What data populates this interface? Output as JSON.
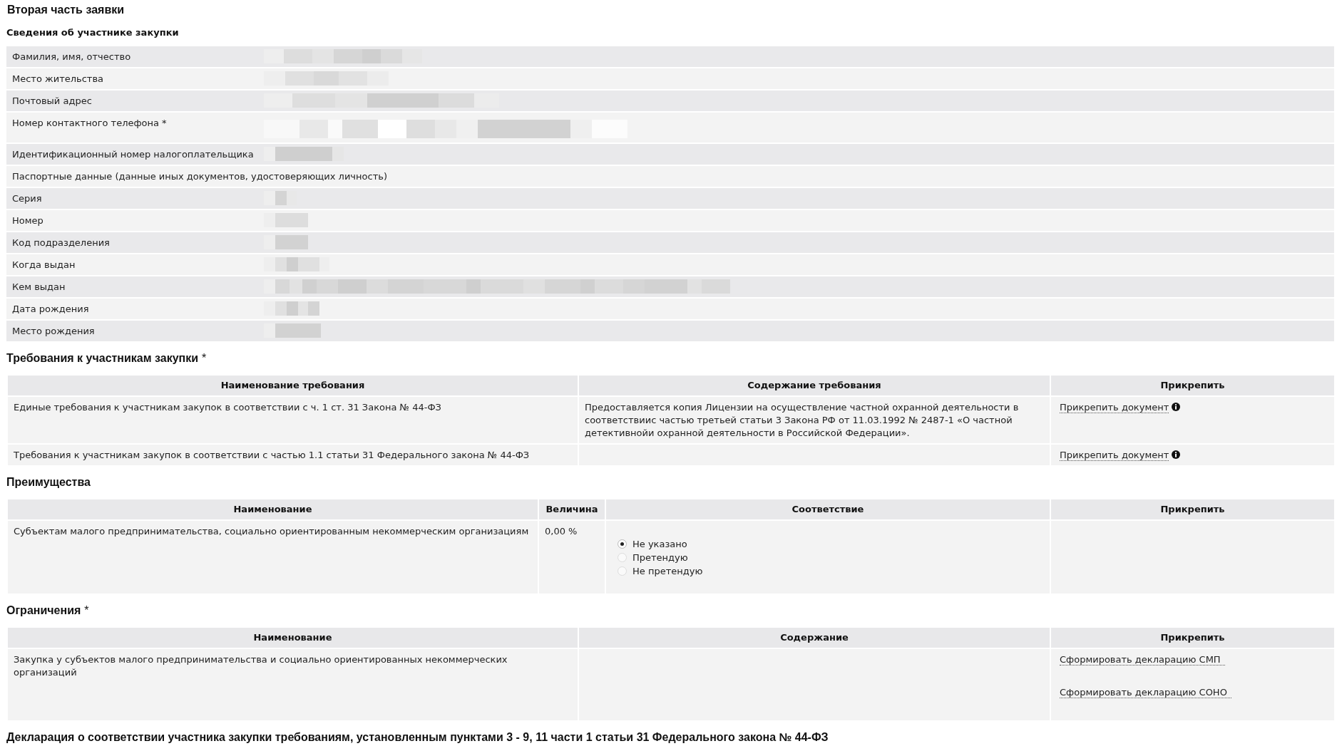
{
  "page": {
    "title": "Вторая часть заявки"
  },
  "participant": {
    "heading": "Сведения об участнике закупки",
    "rows": [
      {
        "label": "Фамилия, имя, отчество",
        "kind": "redacted"
      },
      {
        "label": "Место жительства",
        "kind": "redacted"
      },
      {
        "label": "Почтовый адрес",
        "kind": "redacted"
      },
      {
        "label": "Номер контактного телефона *",
        "kind": "redacted-multiline"
      },
      {
        "label": "Идентификационный номер налогоплательщика",
        "kind": "redacted"
      },
      {
        "label": "Паспортные данные (данные иных документов, удостоверяющих личность)",
        "kind": "group"
      },
      {
        "label": "Серия",
        "kind": "redacted"
      },
      {
        "label": "Номер",
        "kind": "redacted"
      },
      {
        "label": "Код подразделения",
        "kind": "redacted"
      },
      {
        "label": "Когда выдан",
        "kind": "redacted"
      },
      {
        "label": "Кем выдан",
        "kind": "redacted"
      },
      {
        "label": "Дата рождения",
        "kind": "redacted"
      },
      {
        "label": "Место рождения",
        "kind": "redacted"
      }
    ]
  },
  "requirements": {
    "heading": "Требования к участникам закупки",
    "mark": "*",
    "columns": [
      "Наименование требования",
      "Содержание требования",
      "Прикрепить"
    ],
    "rows": [
      {
        "name": "Единые требования к участникам закупок в соответствии с ч. 1 ст. 31 Закона № 44-ФЗ",
        "content": "Предоставляется копия Лицензии на осуществление частной охранной деятельности в соответствиис частью третьей статьи 3 Закона РФ от 11.03.1992 № 2487-1 «О частной детективнойи охранной деятельности в Российской Федерации».",
        "link": "Прикрепить документ",
        "info": true
      },
      {
        "name": "Требования к участникам закупок в соответствии с частью 1.1 статьи 31 Федерального закона № 44-ФЗ",
        "link": "Прикрепить документ",
        "info": true
      }
    ]
  },
  "advantages": {
    "heading": "Преимущества",
    "columns": [
      "Наименование",
      "Величина",
      "Соответствие",
      "Прикрепить"
    ],
    "rows": [
      {
        "name": "Субъектам малого предпринимательства, социально ориентированным некоммерческим организациям",
        "value": "0,00 %",
        "options": [
          {
            "label": "Не указано",
            "selected": true
          },
          {
            "label": "Претендую",
            "selected": false
          },
          {
            "label": "Не претендую",
            "selected": false
          }
        ]
      }
    ]
  },
  "restrictions": {
    "heading": "Ограничения",
    "mark": "*",
    "columns": [
      "Наименование",
      "Содержание",
      "Прикрепить"
    ],
    "rows": [
      {
        "name": "Закупка у субъектов малого предпринимательства и социально ориентированных некоммерческих организаций",
        "links": [
          "Сформировать декларацию СМП",
          "Сформировать декларацию СОНО"
        ]
      }
    ]
  },
  "declaration": {
    "heading": "Декларация о соответствии участника закупки требованиям, установленным пунктами 3 - 9, 11 части 1 статьи 31 Федерального закона № 44-ФЗ"
  }
}
